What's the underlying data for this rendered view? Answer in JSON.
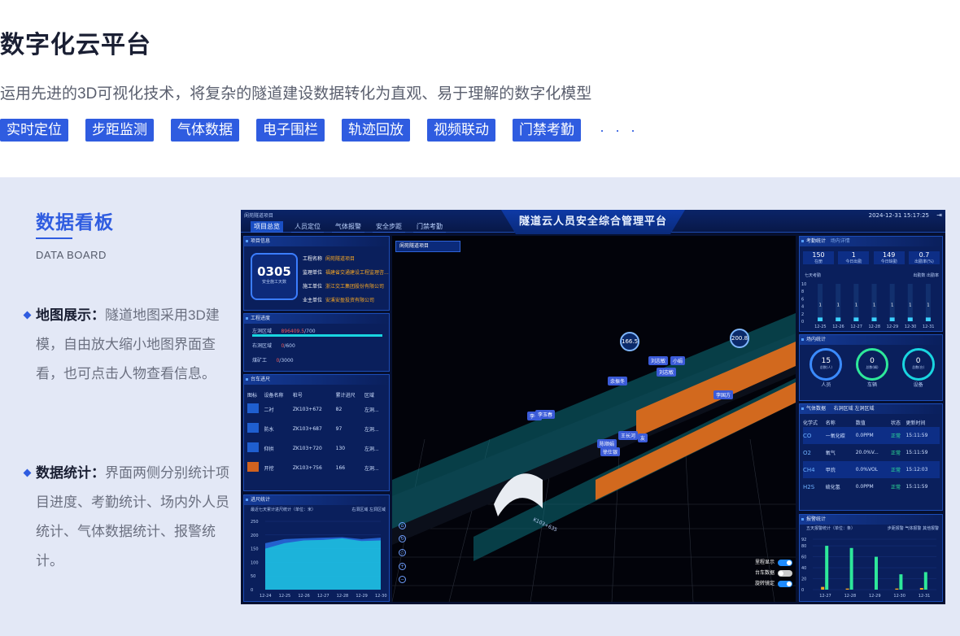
{
  "header": {
    "title": "数字化云平台",
    "subtitle": "运用先进的3D可视化技术，将复杂的隧道建设数据转化为直观、易于理解的数字化模型",
    "tags": [
      "实时定位",
      "步距监测",
      "气体数据",
      "电子围栏",
      "轨迹回放",
      "视频联动",
      "门禁考勤"
    ],
    "more": "· · ·"
  },
  "board": {
    "title": "数据看板",
    "subtitle": "DATA BOARD",
    "features": [
      {
        "label": "地图展示：",
        "text": "隧道地图采用3D建模，自由放大缩小地图界面查看，也可点击人物查看信息。"
      },
      {
        "label": "数据统计：",
        "text": "界面两侧分别统计项目进度、考勤统计、场内外人员统计、气体数据统计、报警统计。"
      }
    ]
  },
  "dashboard": {
    "title": "隧道云人员安全综合管理平台",
    "crumb": "阆苑隧道项目",
    "datetime": "2024-12-31 15:17:25",
    "nav": [
      "项目总览",
      "人员定位",
      "气体报警",
      "安全步距",
      "门禁考勤"
    ],
    "project": {
      "title": "项目信息",
      "days": "0305",
      "days_label": "安全施工天数",
      "rows": [
        {
          "k": "工程名称",
          "v": "阆苑隧道项目"
        },
        {
          "k": "监理单位",
          "v": "福建省交通建设工程监理咨..."
        },
        {
          "k": "施工单位",
          "v": "浙江交工集团股份有限公司"
        },
        {
          "k": "业主单位",
          "v": "安溪安盈投资有限公司"
        }
      ]
    },
    "progress": {
      "title": "工程进度",
      "rows": [
        {
          "k": "左洞区域",
          "v": "896409.5",
          "t": "/700"
        },
        {
          "k": "右洞区域",
          "v": "0",
          "t": "/600"
        },
        {
          "k": "煤矿工",
          "v": "0",
          "t": "/3000"
        }
      ]
    },
    "trolley": {
      "title": "台车进尺",
      "headers": [
        "图标",
        "设备名称",
        "桩号",
        "累计进尺",
        "区域"
      ],
      "rows": [
        [
          "二衬",
          "ZK103+672",
          "82",
          "左洞..."
        ],
        [
          "防水",
          "ZK103+687",
          "97",
          "左洞..."
        ],
        [
          "仰拱",
          "ZK103+720",
          "130",
          "左洞..."
        ],
        [
          "开挖",
          "ZK103+756",
          "166",
          "左洞..."
        ]
      ]
    },
    "advance": {
      "title": "进尺统计",
      "subtitle": "最近七天累计进尺统计（单位：米）",
      "legend": [
        "右洞区域",
        "左洞区域"
      ],
      "yticks": [
        "250",
        "200",
        "150",
        "100",
        "50",
        "0"
      ],
      "xticks": [
        "12-24",
        "12-25",
        "12-26",
        "12-27",
        "12-28",
        "12-29",
        "12-30"
      ]
    },
    "scene": {
      "project_select": "阆苑隧道项目",
      "circles": [
        "166.5",
        "200.8"
      ],
      "people": [
        "刘志敏",
        "小娟",
        "刘志敏",
        "余振冬",
        "李国方",
        "李一",
        "李玉春",
        "王长河",
        "陈顺娟",
        "徐仕银",
        "友"
      ],
      "stake": "K103+635",
      "toggles": [
        "里程显示",
        "台车数据",
        "旋转镜定"
      ]
    },
    "attendance": {
      "title": "考勤统计",
      "tab2": "场内详情",
      "stats": [
        {
          "v": "150",
          "k": "在册"
        },
        {
          "v": "1",
          "k": "今日出勤"
        },
        {
          "v": "149",
          "k": "今日缺勤"
        },
        {
          "v": "0.7",
          "k": "出勤率(%)"
        }
      ],
      "chart_title": "七天考勤",
      "legend": [
        "出勤数",
        "出勤率"
      ],
      "xticks": [
        "12-25",
        "12-26",
        "12-27",
        "12-28",
        "12-29",
        "12-30",
        "12-31"
      ]
    },
    "inside": {
      "title": "场内统计",
      "items": [
        {
          "v": "15",
          "u": "总数(人)",
          "k": "人员"
        },
        {
          "v": "0",
          "u": "总数(辆)",
          "k": "车辆"
        },
        {
          "v": "0",
          "u": "总数(台)",
          "k": "设备"
        }
      ]
    },
    "gas": {
      "title": "气体数据",
      "zones": [
        "右洞区域",
        "左洞区域"
      ],
      "headers": [
        "化学式",
        "名称",
        "数值",
        "状态",
        "更新时间"
      ],
      "rows": [
        [
          "CO",
          "一氧化碳",
          "0.0PPM",
          "正常",
          "15:11:59"
        ],
        [
          "O2",
          "氧气",
          "20.0%V...",
          "正常",
          "15:11:59"
        ],
        [
          "CH4",
          "甲烷",
          "0.0%VOL",
          "正常",
          "15:12:03"
        ],
        [
          "H2S",
          "硫化氢",
          "0.0PPM",
          "正常",
          "15:11:59"
        ]
      ]
    },
    "alarm": {
      "title": "报警统计",
      "subtitle": "五天报警统计（单位：条）",
      "legend": [
        "步距报警",
        "气体报警",
        "其他报警"
      ],
      "yticks": [
        "92",
        "80",
        "60",
        "40",
        "20",
        "0"
      ],
      "xticks": [
        "12-27",
        "12-28",
        "12-29",
        "12-30",
        "12-31"
      ]
    }
  },
  "chart_data": [
    {
      "type": "bar",
      "title": "七天考勤",
      "categories": [
        "12-25",
        "12-26",
        "12-27",
        "12-28",
        "12-29",
        "12-30",
        "12-31"
      ],
      "series": [
        {
          "name": "出勤数",
          "values": [
            1,
            1,
            1,
            1,
            1,
            1,
            1
          ]
        }
      ],
      "ylim": [
        0,
        10
      ]
    },
    {
      "type": "area",
      "title": "最近七天累计进尺统计（单位：米）",
      "categories": [
        "12-24",
        "12-25",
        "12-26",
        "12-27",
        "12-28",
        "12-29",
        "12-30"
      ],
      "series": [
        {
          "name": "右洞区域",
          "values": [
            170,
            185,
            188,
            190,
            192,
            185,
            190
          ]
        },
        {
          "name": "左洞区域",
          "values": [
            150,
            170,
            180,
            182,
            188,
            178,
            180
          ]
        }
      ],
      "ylim": [
        0,
        250
      ]
    },
    {
      "type": "bar",
      "title": "五天报警统计（单位：条）",
      "categories": [
        "12-27",
        "12-28",
        "12-29",
        "12-30",
        "12-31"
      ],
      "series": [
        {
          "name": "步距报警",
          "values": [
            5,
            2,
            0,
            2,
            3
          ]
        },
        {
          "name": "其他报警",
          "values": [
            80,
            76,
            60,
            28,
            32
          ]
        }
      ],
      "ylim": [
        0,
        92
      ]
    }
  ],
  "colors": {
    "accent": "#2f5ce0",
    "panel": "#0a1f5c",
    "bg": "#e3e8f6",
    "green": "#2ee89a",
    "cyan": "#19d5e0"
  }
}
